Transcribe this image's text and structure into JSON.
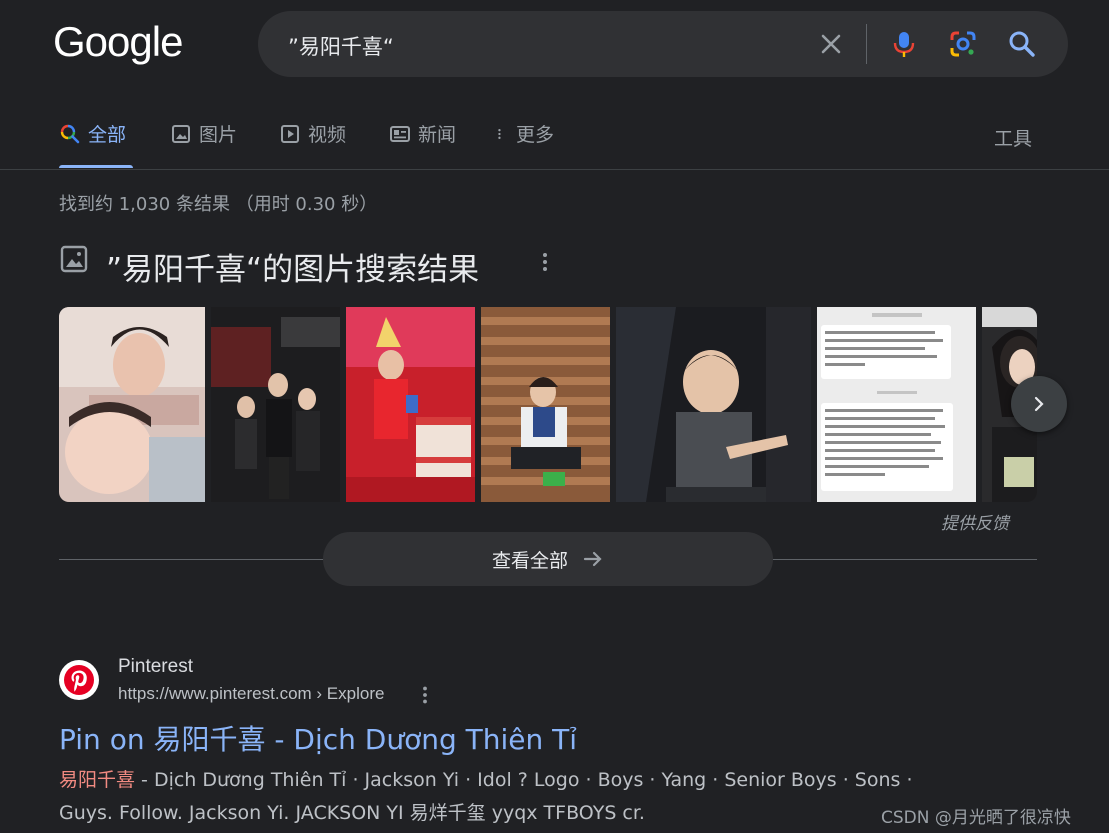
{
  "logo": "Google",
  "search": {
    "query": "”易阳千喜“"
  },
  "tabs": [
    {
      "label": "全部",
      "icon": "search-icon",
      "active": true
    },
    {
      "label": "图片",
      "icon": "image-icon"
    },
    {
      "label": "视频",
      "icon": "video-icon"
    },
    {
      "label": "新闻",
      "icon": "news-icon"
    },
    {
      "label": "更多",
      "icon": "more-vert-icon"
    }
  ],
  "tools_label": "工具",
  "stats": "找到约 1,030 条结果 （用时 0.30 秒）",
  "images_section": {
    "title": "”易阳千喜“的图片搜索结果",
    "feedback": "提供反馈",
    "view_all": "查看全部"
  },
  "result": {
    "site_name": "Pinterest",
    "url": "https://www.pinterest.com › Explore",
    "title": "Pin on 易阳千喜 - Dịch Dương Thiên Tỉ",
    "snippet_highlight": "易阳千喜",
    "snippet_line1": " - Dịch Dương Thiên Tỉ · Jackson Yi · Idol ? Logo · Boys · Yang · Senior Boys · Sons ·",
    "snippet_line2": "Guys. Follow. Jackson Yi. JACKSON YI 易烊千玺 yyqx TFBOYS cr."
  },
  "watermark": "CSDN @月光晒了很凉快",
  "colors": {
    "background": "#202124",
    "accent": "#8ab4f8",
    "highlight": "#f28b82",
    "searchbox": "#303134"
  }
}
